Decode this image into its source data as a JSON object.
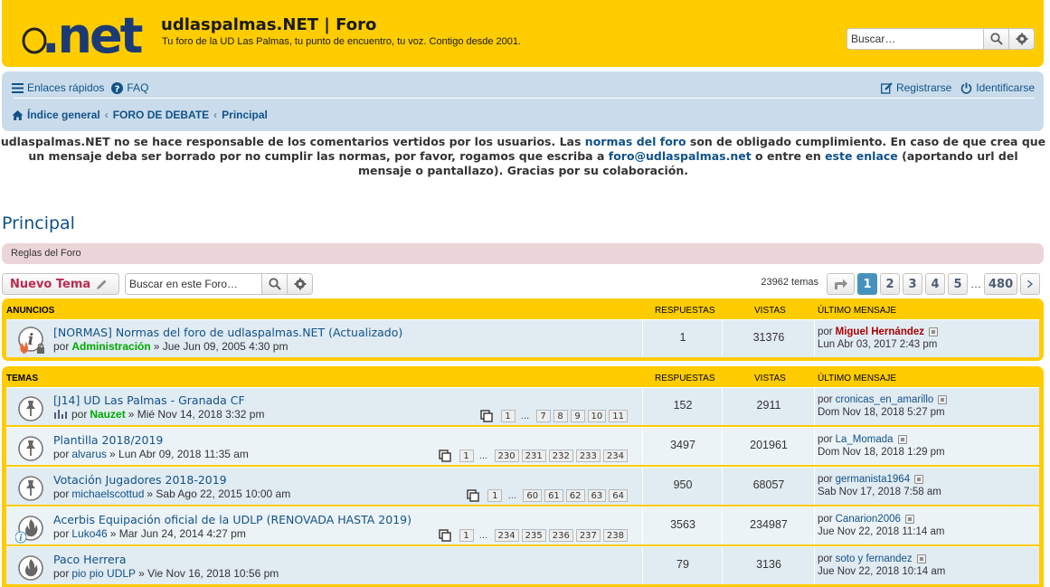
{
  "header": {
    "title": "udlaspalmas.NET | Foro",
    "description": "Tu foro de la UD Las Palmas, tu punto de encuentro, tu voz. Contigo desde 2001.",
    "logo_text": ".net",
    "search_placeholder": "Buscar…",
    "search_icon": "search-icon",
    "advanced_icon": "gear-icon"
  },
  "navbar": {
    "quick_links": "Enlaces rápidos",
    "faq": "FAQ",
    "register": "Registrarse",
    "login": "Identificarse",
    "breadcrumbs": [
      "Índice general",
      "FORO DE DEBATE",
      "Principal"
    ]
  },
  "notice": {
    "part1": "udlaspalmas.NET no se hace responsable de los comentarios vertidos por los usuarios. Las ",
    "link1": "normas del foro",
    "part2": " son de obligado cumplimiento. En caso de que crea que un mensaje deba ser borrado por no cumplir las normas, por favor, rogamos que escriba a ",
    "link2": "foro@udlaspalmas.net",
    "part3": " o entre en ",
    "link3": "este enlace",
    "part4": " (aportando url del mensaje o pantallazo). Gracias por su colaboración."
  },
  "forum": {
    "title": "Principal",
    "rules_label": "Reglas del Foro",
    "new_topic": "Nuevo Tema",
    "search_placeholder": "Buscar en este Foro…",
    "topics_count": "23962 temas",
    "pages": [
      "1",
      "2",
      "3",
      "4",
      "5"
    ],
    "last_page": "480",
    "ellipsis": "…"
  },
  "columns": {
    "announcements": "ANUNCIOS",
    "topics": "TEMAS",
    "replies": "RESPUESTAS",
    "views": "VISTAS",
    "last_post": "ÚLTIMO MENSAJE"
  },
  "announcements": [
    {
      "title": "[NORMAS] Normas del foro de udlaspalmas.NET (Actualizado)",
      "by": "por",
      "author": "Administración",
      "date": "» Jue Jun 09, 2005 4:30 pm",
      "replies": "1",
      "views": "31376",
      "last_by": "por",
      "last_author": "Miguel Hernández",
      "last_date": "Lun Abr 03, 2017 2:43 pm"
    }
  ],
  "topics": [
    {
      "title": "[J14] UD Las Palmas - Granada CF",
      "by": "por",
      "author": "Nauzet",
      "date": "» Mié Nov 14, 2018 3:32 pm",
      "pages_first": "1",
      "pages_dots": "…",
      "pages_last": [
        "7",
        "8",
        "9",
        "10",
        "11"
      ],
      "replies": "152",
      "views": "2911",
      "last_by": "por",
      "last_author": "cronicas_en_amarillo",
      "last_date": "Dom Nov 18, 2018 5:27 pm"
    },
    {
      "title": "Plantilla 2018/2019",
      "by": "por",
      "author": "alvarus",
      "date": "» Lun Abr 09, 2018 11:35 am",
      "pages_first": "1",
      "pages_dots": "…",
      "pages_last": [
        "230",
        "231",
        "232",
        "233",
        "234"
      ],
      "replies": "3497",
      "views": "201961",
      "last_by": "por",
      "last_author": "La_Momada",
      "last_date": "Dom Nov 18, 2018 1:29 pm"
    },
    {
      "title": "Votación Jugadores 2018-2019",
      "by": "por",
      "author": "michaelscottud",
      "date": "» Sab Ago 22, 2015 10:00 am",
      "pages_first": "1",
      "pages_dots": "…",
      "pages_last": [
        "60",
        "61",
        "62",
        "63",
        "64"
      ],
      "replies": "950",
      "views": "68057",
      "last_by": "por",
      "last_author": "germanista1964",
      "last_date": "Sab Nov 17, 2018 7:58 am"
    },
    {
      "title": "Acerbis Equipación oficial de la UDLP (RENOVADA HASTA 2019)",
      "by": "por",
      "author": "Luko46",
      "date": "» Mar Jun 24, 2014 4:27 pm",
      "pages_first": "1",
      "pages_dots": "…",
      "pages_last": [
        "234",
        "235",
        "236",
        "237",
        "238"
      ],
      "replies": "3563",
      "views": "234987",
      "last_by": "por",
      "last_author": "Canarion2006",
      "last_date": "Jue Nov 22, 2018 11:14 am"
    },
    {
      "title": "Paco Herrera",
      "by": "por",
      "author": "pio pio UDLP",
      "date": "» Vie Nov 16, 2018 10:56 pm",
      "replies": "79",
      "views": "3136",
      "last_by": "por",
      "last_author": "soto y fernandez",
      "last_date": "Jue Nov 22, 2018 10:14 am"
    }
  ],
  "colors": {
    "brand_yellow": "#ffcc00",
    "nav_blue": "#cadceb",
    "link_blue": "#105289",
    "admin_green": "#00aa00",
    "mod_red": "#aa0000",
    "rules_pink": "#ecd5d8",
    "active_page": "#4692bf"
  }
}
